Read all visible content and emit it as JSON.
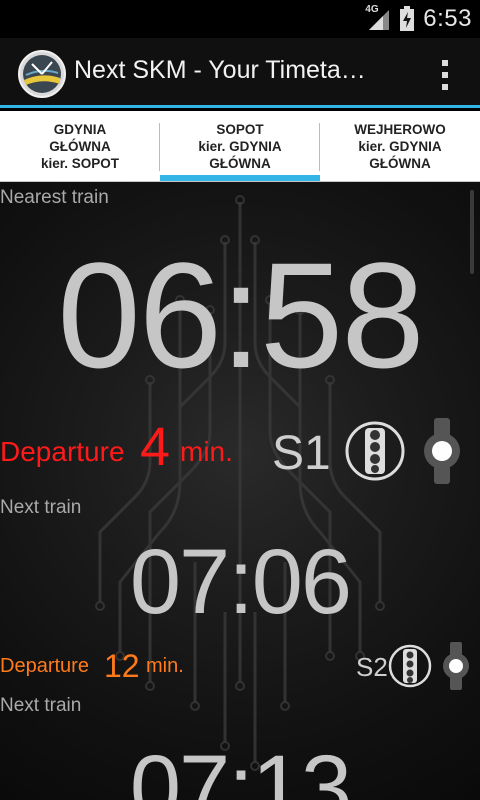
{
  "status_bar": {
    "network": "4G",
    "time": "6:53"
  },
  "action_bar": {
    "title": "Next SKM - Your Timeta…"
  },
  "tabs": [
    {
      "line1": "GDYNIA",
      "line2": "GŁÓWNA",
      "line3": "kier. SOPOT",
      "active": false
    },
    {
      "line1": "SOPOT",
      "line2": "kier. GDYNIA",
      "line3": "GŁÓWNA",
      "active": true
    },
    {
      "line1": "WEJHEROWO",
      "line2": "kier. GDYNIA",
      "line3": "GŁÓWNA",
      "active": false
    }
  ],
  "trains": [
    {
      "label": "Nearest train",
      "time": "06:58",
      "departure_word": "Departure",
      "minutes": "4",
      "unit": "min.",
      "line": "S1",
      "color": "#ff1a1a"
    },
    {
      "label": "Next train",
      "time": "07:06",
      "departure_word": "Departure",
      "minutes": "12",
      "unit": "min.",
      "line": "S2",
      "color": "#ff7a1a"
    },
    {
      "label": "Next train",
      "time": "07:13"
    }
  ],
  "colors": {
    "accent": "#33b5e5"
  }
}
